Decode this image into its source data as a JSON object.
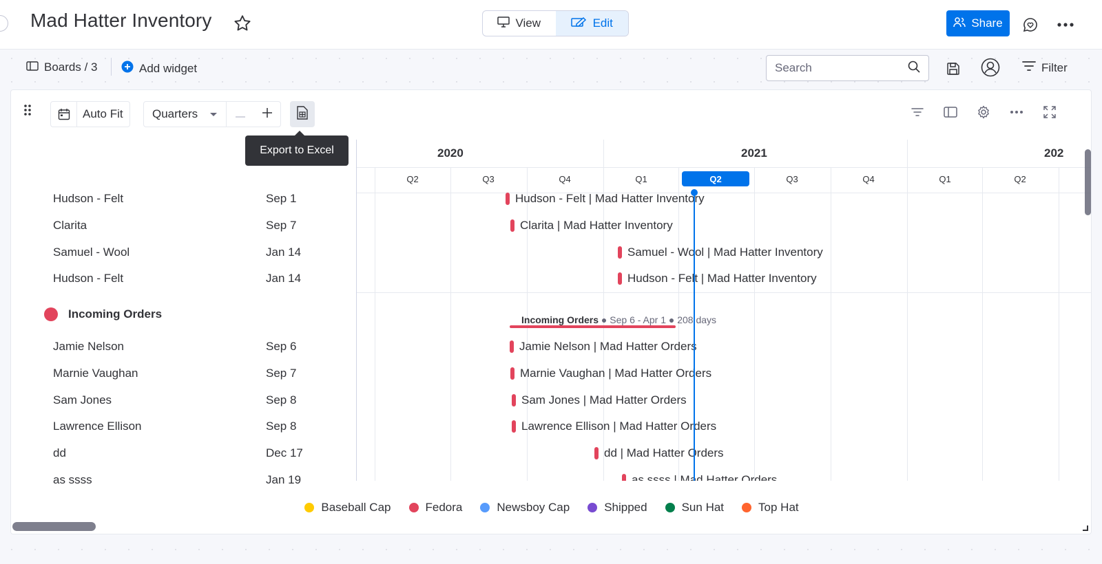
{
  "header": {
    "title": "Mad Hatter Inventory",
    "view_label": "View",
    "edit_label": "Edit",
    "share_label": "Share"
  },
  "toolbar": {
    "boards_label": "Boards / 3",
    "add_widget_label": "Add widget",
    "search_placeholder": "Search",
    "filter_label": "Filter"
  },
  "widget": {
    "autofit_label": "Auto Fit",
    "scale_label": "Quarters",
    "export_tooltip": "Export to Excel"
  },
  "timeline": {
    "years": [
      "2020",
      "2021",
      "202"
    ],
    "quarters": [
      "Q2",
      "Q3",
      "Q4",
      "Q1",
      "Q2",
      "Q3",
      "Q4",
      "Q1",
      "Q2"
    ],
    "current_quarter_index": 4
  },
  "list": {
    "top_rows": [
      {
        "name": "Hudson - Felt",
        "date": "Sep 1",
        "bar_label": "Hudson - Felt | Mad Hatter Inventory"
      },
      {
        "name": "Clarita",
        "date": "Sep 7",
        "bar_label": "Clarita | Mad Hatter Inventory"
      },
      {
        "name": "Samuel - Wool",
        "date": "Jan 14",
        "bar_label": "Samuel - Wool | Mad Hatter Inventory"
      },
      {
        "name": "Hudson - Felt",
        "date": "Jan 14",
        "bar_label": "Hudson - Felt | Mad Hatter Inventory"
      }
    ],
    "group": {
      "name": "Incoming Orders",
      "color": "#e2445c",
      "summary_name": "Incoming Orders",
      "summary_range": "● Sep 6 - Apr 1 ● 208 days"
    },
    "group_rows": [
      {
        "name": "Jamie Nelson",
        "date": "Sep 6",
        "bar_label": "Jamie Nelson | Mad Hatter Orders"
      },
      {
        "name": "Marnie Vaughan",
        "date": "Sep 7",
        "bar_label": "Marnie Vaughan | Mad Hatter Orders"
      },
      {
        "name": "Sam Jones",
        "date": "Sep 8",
        "bar_label": "Sam Jones | Mad Hatter Orders"
      },
      {
        "name": "Lawrence Ellison",
        "date": "Sep 8",
        "bar_label": "Lawrence Ellison | Mad Hatter Orders"
      },
      {
        "name": "dd",
        "date": "Dec 17",
        "bar_label": "dd | Mad Hatter Orders"
      },
      {
        "name": "as ssss",
        "date": "Jan 19",
        "bar_label": "as ssss | Mad Hatter Orders"
      }
    ]
  },
  "legend": [
    {
      "label": "Baseball Cap",
      "color": "#ffcb00"
    },
    {
      "label": "Fedora",
      "color": "#e2445c"
    },
    {
      "label": "Newsboy Cap",
      "color": "#579bfc"
    },
    {
      "label": "Shipped",
      "color": "#784bd1"
    },
    {
      "label": "Sun Hat",
      "color": "#037f4c"
    },
    {
      "label": "Top Hat",
      "color": "#ff642e"
    }
  ],
  "colors": {
    "accent": "#0073ea",
    "item_marker": "#e2445c"
  }
}
